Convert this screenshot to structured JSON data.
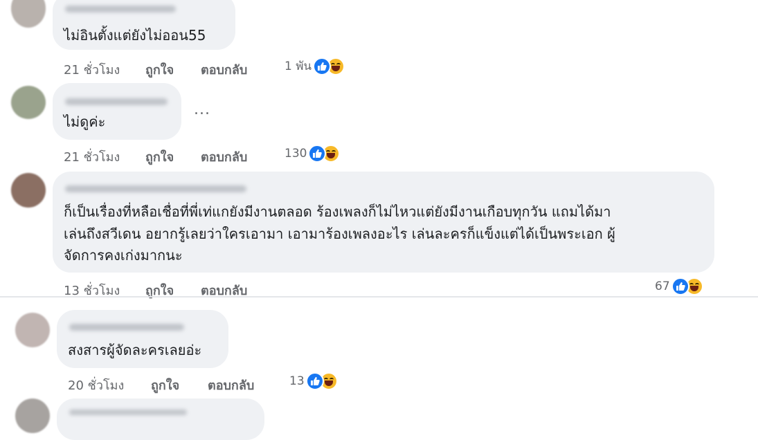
{
  "comments": [
    {
      "text": [
        "ไม่อินตั้งแต่ยังไม่ออน55"
      ],
      "time": "21 ชั่วโมง",
      "like": "ถูกใจ",
      "reply": "ตอบกลับ",
      "reactions": "1 พัน"
    },
    {
      "text": [
        "ไม่ดูค่ะ"
      ],
      "time": "21 ชั่วโมง",
      "like": "ถูกใจ",
      "reply": "ตอบกลับ",
      "reactions": "130",
      "more": "..."
    },
    {
      "text": [
        "ก็เป็นเรื่องที่หลือเชื่อที่พี่เท่แกยังมีงานตลอด ร้องเพลงก็ไม่ไหวแต่ยังมีงานเกือบทุกวัน แถมได้มา",
        "เล่นถึงสวีเดน อยากรู้เลยว่าใครเอามา เอามาร้องเพลงอะไร เล่นละครก็แข็งแต่ได้เป็นพระเอก ผู้",
        "จัดการคงเก่งมากนะ"
      ],
      "time": "13 ชั่วโมง",
      "like": "ถูกใจ",
      "reply": "ตอบกลับ",
      "reactions": "67"
    },
    {
      "text": [
        "สงสารผู้จัดละครเลยอ่ะ"
      ],
      "time": "20 ชั่วโมง",
      "like": "ถูกใจ",
      "reply": "ตอบกลับ",
      "reactions": "13"
    }
  ],
  "icons": {
    "like": "like-reaction-icon",
    "haha": "haha-reaction-icon"
  },
  "colors": {
    "bubble": "#eff1f4",
    "like": "#1877f2",
    "haha": "#f7b928",
    "meta": "#65676b"
  }
}
